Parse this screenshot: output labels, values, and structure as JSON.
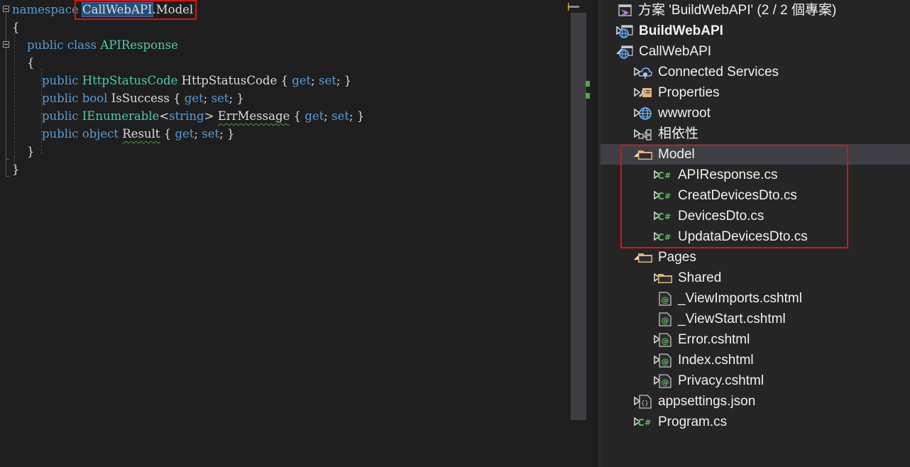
{
  "editor": {
    "lines": [
      [
        {
          "t": "namespace",
          "c": "kw"
        },
        {
          "t": " ",
          "c": "tx"
        },
        {
          "t": "CallWebAPI",
          "c": "tx",
          "sel": true
        },
        {
          "t": ".Model",
          "c": "tx"
        }
      ],
      [
        {
          "t": "{",
          "c": "pn"
        }
      ],
      [
        {
          "t": "    public class ",
          "c": "kw"
        },
        {
          "t": "APIResponse",
          "c": "ty"
        }
      ],
      [
        {
          "t": "    {",
          "c": "pn"
        }
      ],
      [
        {
          "t": "        public ",
          "c": "kw"
        },
        {
          "t": "HttpStatusCode",
          "c": "ty"
        },
        {
          "t": " HttpStatusCode { ",
          "c": "tx"
        },
        {
          "t": "get",
          "c": "kw"
        },
        {
          "t": "; ",
          "c": "tx"
        },
        {
          "t": "set",
          "c": "kw"
        },
        {
          "t": "; }",
          "c": "tx"
        }
      ],
      [
        {
          "t": "        public bool ",
          "c": "kw"
        },
        {
          "t": "IsSuccess { ",
          "c": "tx"
        },
        {
          "t": "get",
          "c": "kw"
        },
        {
          "t": "; ",
          "c": "tx"
        },
        {
          "t": "set",
          "c": "kw"
        },
        {
          "t": "; }",
          "c": "tx"
        }
      ],
      [
        {
          "t": "        public ",
          "c": "kw"
        },
        {
          "t": "IEnumerable",
          "c": "ty"
        },
        {
          "t": "<",
          "c": "tx"
        },
        {
          "t": "string",
          "c": "kw"
        },
        {
          "t": "> ",
          "c": "tx"
        },
        {
          "t": "ErrMessage",
          "c": "tx",
          "squig": true
        },
        {
          "t": " { ",
          "c": "tx"
        },
        {
          "t": "get",
          "c": "kw"
        },
        {
          "t": "; ",
          "c": "tx"
        },
        {
          "t": "set",
          "c": "kw"
        },
        {
          "t": "; }",
          "c": "tx"
        }
      ],
      [
        {
          "t": "        public object ",
          "c": "kw"
        },
        {
          "t": "Result",
          "c": "tx",
          "squig": true
        },
        {
          "t": " { ",
          "c": "tx"
        },
        {
          "t": "get",
          "c": "kw"
        },
        {
          "t": "; ",
          "c": "tx"
        },
        {
          "t": "set",
          "c": "kw"
        },
        {
          "t": "; }",
          "c": "tx"
        }
      ],
      [
        {
          "t": "    }",
          "c": "pn"
        }
      ],
      [
        {
          "t": "}",
          "c": "pn"
        }
      ]
    ]
  },
  "explorer": {
    "rows": [
      {
        "label": "方案 'BuildWebAPI' (2 / 2 個專案)",
        "icon": "solution-icon",
        "arrow": "none",
        "indent": 0,
        "bold": false,
        "name": "solution-root"
      },
      {
        "label": "BuildWebAPI",
        "icon": "web-project-icon",
        "arrow": "collapsed",
        "indent": 0,
        "bold": true,
        "name": "project-buildwebapi"
      },
      {
        "label": "CallWebAPI",
        "icon": "web-project-icon",
        "arrow": "expanded",
        "indent": 0,
        "bold": false,
        "name": "project-callwebapi"
      },
      {
        "label": "Connected Services",
        "icon": "connected-services-icon",
        "arrow": "collapsed",
        "indent": 1,
        "bold": false,
        "name": "node-connected-services"
      },
      {
        "label": "Properties",
        "icon": "properties-icon",
        "arrow": "collapsed",
        "indent": 1,
        "bold": false,
        "name": "node-properties"
      },
      {
        "label": "wwwroot",
        "icon": "globe-icon",
        "arrow": "collapsed",
        "indent": 1,
        "bold": false,
        "name": "node-wwwroot"
      },
      {
        "label": "相依性",
        "icon": "dependencies-icon",
        "arrow": "collapsed",
        "indent": 1,
        "bold": false,
        "name": "node-dependencies"
      },
      {
        "label": "Model",
        "icon": "folder-icon",
        "arrow": "expanded",
        "indent": 1,
        "bold": false,
        "name": "folder-model",
        "selected": true
      },
      {
        "label": "APIResponse.cs",
        "icon": "csharp-file-icon",
        "arrow": "collapsed",
        "indent": 2,
        "bold": false,
        "name": "file-apiresponse"
      },
      {
        "label": "CreatDevicesDto.cs",
        "icon": "csharp-file-icon",
        "arrow": "collapsed",
        "indent": 2,
        "bold": false,
        "name": "file-creatdevicesdto"
      },
      {
        "label": "DevicesDto.cs",
        "icon": "csharp-file-icon",
        "arrow": "collapsed",
        "indent": 2,
        "bold": false,
        "name": "file-devicesdto"
      },
      {
        "label": "UpdataDevicesDto.cs",
        "icon": "csharp-file-icon",
        "arrow": "collapsed",
        "indent": 2,
        "bold": false,
        "name": "file-updatadevicesdto"
      },
      {
        "label": "Pages",
        "icon": "folder-icon",
        "arrow": "expanded",
        "indent": 1,
        "bold": false,
        "name": "folder-pages"
      },
      {
        "label": "Shared",
        "icon": "folder-icon",
        "arrow": "collapsed",
        "indent": 2,
        "bold": false,
        "name": "folder-shared"
      },
      {
        "label": "_ViewImports.cshtml",
        "icon": "razor-file-icon",
        "arrow": "none",
        "indent": 2,
        "bold": false,
        "name": "file-viewimports"
      },
      {
        "label": "_ViewStart.cshtml",
        "icon": "razor-file-icon",
        "arrow": "none",
        "indent": 2,
        "bold": false,
        "name": "file-viewstart"
      },
      {
        "label": "Error.cshtml",
        "icon": "razor-file-icon",
        "arrow": "collapsed",
        "indent": 2,
        "bold": false,
        "name": "file-error"
      },
      {
        "label": "Index.cshtml",
        "icon": "razor-file-icon",
        "arrow": "collapsed",
        "indent": 2,
        "bold": false,
        "name": "file-index"
      },
      {
        "label": "Privacy.cshtml",
        "icon": "razor-file-icon",
        "arrow": "collapsed",
        "indent": 2,
        "bold": false,
        "name": "file-privacy"
      },
      {
        "label": "appsettings.json",
        "icon": "json-file-icon",
        "arrow": "collapsed",
        "indent": 1,
        "bold": false,
        "name": "file-appsettings"
      },
      {
        "label": "Program.cs",
        "icon": "csharp-file-icon",
        "arrow": "collapsed",
        "indent": 1,
        "bold": false,
        "name": "file-program"
      }
    ]
  },
  "colors": {
    "keyword": "#569cd6",
    "type": "#4ec9b0",
    "text": "#dcdcdc",
    "highlight": "#e01010",
    "csharp": "#5fbf5f",
    "folder": "#dcb67a"
  }
}
